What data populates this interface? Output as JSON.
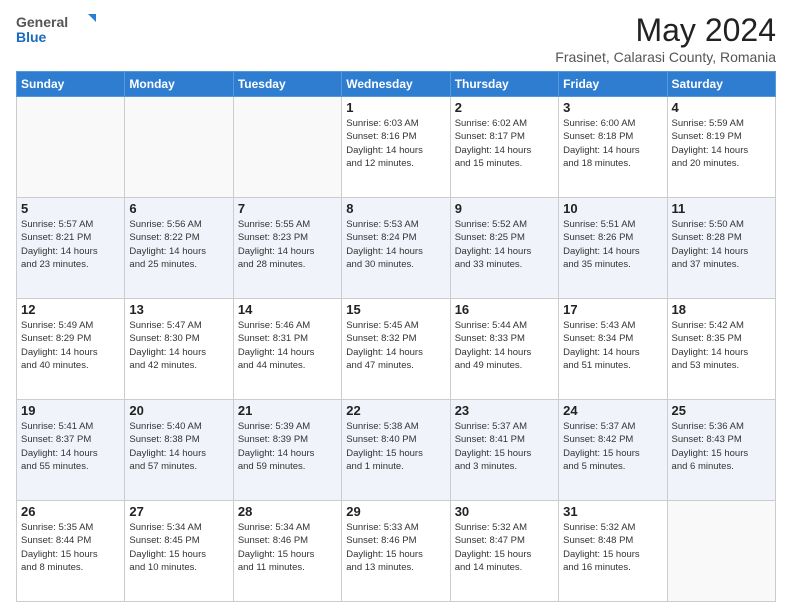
{
  "header": {
    "logo_general": "General",
    "logo_blue": "Blue",
    "month_title": "May 2024",
    "subtitle": "Frasinet, Calarasi County, Romania"
  },
  "weekdays": [
    "Sunday",
    "Monday",
    "Tuesday",
    "Wednesday",
    "Thursday",
    "Friday",
    "Saturday"
  ],
  "weeks": [
    [
      {
        "day": "",
        "info": ""
      },
      {
        "day": "",
        "info": ""
      },
      {
        "day": "",
        "info": ""
      },
      {
        "day": "1",
        "info": "Sunrise: 6:03 AM\nSunset: 8:16 PM\nDaylight: 14 hours\nand 12 minutes."
      },
      {
        "day": "2",
        "info": "Sunrise: 6:02 AM\nSunset: 8:17 PM\nDaylight: 14 hours\nand 15 minutes."
      },
      {
        "day": "3",
        "info": "Sunrise: 6:00 AM\nSunset: 8:18 PM\nDaylight: 14 hours\nand 18 minutes."
      },
      {
        "day": "4",
        "info": "Sunrise: 5:59 AM\nSunset: 8:19 PM\nDaylight: 14 hours\nand 20 minutes."
      }
    ],
    [
      {
        "day": "5",
        "info": "Sunrise: 5:57 AM\nSunset: 8:21 PM\nDaylight: 14 hours\nand 23 minutes."
      },
      {
        "day": "6",
        "info": "Sunrise: 5:56 AM\nSunset: 8:22 PM\nDaylight: 14 hours\nand 25 minutes."
      },
      {
        "day": "7",
        "info": "Sunrise: 5:55 AM\nSunset: 8:23 PM\nDaylight: 14 hours\nand 28 minutes."
      },
      {
        "day": "8",
        "info": "Sunrise: 5:53 AM\nSunset: 8:24 PM\nDaylight: 14 hours\nand 30 minutes."
      },
      {
        "day": "9",
        "info": "Sunrise: 5:52 AM\nSunset: 8:25 PM\nDaylight: 14 hours\nand 33 minutes."
      },
      {
        "day": "10",
        "info": "Sunrise: 5:51 AM\nSunset: 8:26 PM\nDaylight: 14 hours\nand 35 minutes."
      },
      {
        "day": "11",
        "info": "Sunrise: 5:50 AM\nSunset: 8:28 PM\nDaylight: 14 hours\nand 37 minutes."
      }
    ],
    [
      {
        "day": "12",
        "info": "Sunrise: 5:49 AM\nSunset: 8:29 PM\nDaylight: 14 hours\nand 40 minutes."
      },
      {
        "day": "13",
        "info": "Sunrise: 5:47 AM\nSunset: 8:30 PM\nDaylight: 14 hours\nand 42 minutes."
      },
      {
        "day": "14",
        "info": "Sunrise: 5:46 AM\nSunset: 8:31 PM\nDaylight: 14 hours\nand 44 minutes."
      },
      {
        "day": "15",
        "info": "Sunrise: 5:45 AM\nSunset: 8:32 PM\nDaylight: 14 hours\nand 47 minutes."
      },
      {
        "day": "16",
        "info": "Sunrise: 5:44 AM\nSunset: 8:33 PM\nDaylight: 14 hours\nand 49 minutes."
      },
      {
        "day": "17",
        "info": "Sunrise: 5:43 AM\nSunset: 8:34 PM\nDaylight: 14 hours\nand 51 minutes."
      },
      {
        "day": "18",
        "info": "Sunrise: 5:42 AM\nSunset: 8:35 PM\nDaylight: 14 hours\nand 53 minutes."
      }
    ],
    [
      {
        "day": "19",
        "info": "Sunrise: 5:41 AM\nSunset: 8:37 PM\nDaylight: 14 hours\nand 55 minutes."
      },
      {
        "day": "20",
        "info": "Sunrise: 5:40 AM\nSunset: 8:38 PM\nDaylight: 14 hours\nand 57 minutes."
      },
      {
        "day": "21",
        "info": "Sunrise: 5:39 AM\nSunset: 8:39 PM\nDaylight: 14 hours\nand 59 minutes."
      },
      {
        "day": "22",
        "info": "Sunrise: 5:38 AM\nSunset: 8:40 PM\nDaylight: 15 hours\nand 1 minute."
      },
      {
        "day": "23",
        "info": "Sunrise: 5:37 AM\nSunset: 8:41 PM\nDaylight: 15 hours\nand 3 minutes."
      },
      {
        "day": "24",
        "info": "Sunrise: 5:37 AM\nSunset: 8:42 PM\nDaylight: 15 hours\nand 5 minutes."
      },
      {
        "day": "25",
        "info": "Sunrise: 5:36 AM\nSunset: 8:43 PM\nDaylight: 15 hours\nand 6 minutes."
      }
    ],
    [
      {
        "day": "26",
        "info": "Sunrise: 5:35 AM\nSunset: 8:44 PM\nDaylight: 15 hours\nand 8 minutes."
      },
      {
        "day": "27",
        "info": "Sunrise: 5:34 AM\nSunset: 8:45 PM\nDaylight: 15 hours\nand 10 minutes."
      },
      {
        "day": "28",
        "info": "Sunrise: 5:34 AM\nSunset: 8:46 PM\nDaylight: 15 hours\nand 11 minutes."
      },
      {
        "day": "29",
        "info": "Sunrise: 5:33 AM\nSunset: 8:46 PM\nDaylight: 15 hours\nand 13 minutes."
      },
      {
        "day": "30",
        "info": "Sunrise: 5:32 AM\nSunset: 8:47 PM\nDaylight: 15 hours\nand 14 minutes."
      },
      {
        "day": "31",
        "info": "Sunrise: 5:32 AM\nSunset: 8:48 PM\nDaylight: 15 hours\nand 16 minutes."
      },
      {
        "day": "",
        "info": ""
      }
    ]
  ]
}
